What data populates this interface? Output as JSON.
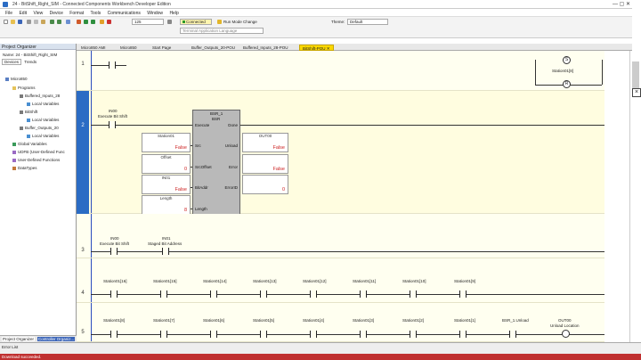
{
  "window": {
    "title": "24 - BitShift_Right_SIM - Connected Components Workbench Developer Edition",
    "controls": "—  ▢  ✕"
  },
  "menu": [
    "File",
    "Edit",
    "View",
    "Device",
    "Format",
    "Tools",
    "Communications",
    "Window",
    "Help"
  ],
  "toolbar": {
    "zoom_value": "125",
    "connection_status": "Connected",
    "run_mode_label": "Run Mode Change",
    "theme_label": "Theme:",
    "theme_value": "Default",
    "language_label": "Terminal Application Language"
  },
  "left_pane": {
    "header": "Project Organizer",
    "name_label": "Name:",
    "project_name": "24 - BitShift_Right_SIM",
    "tabs": [
      "Devices",
      "Trends"
    ],
    "tree": [
      "Micro850",
      "Programs",
      "Buffered_Inputs_28",
      "Local Variables",
      "BitShift",
      "Local Variables",
      "Buffer_Outputs_20",
      "Local Variables",
      "Global Variables",
      "UDFB (User-Defined Func",
      "User-Defined Functions",
      "DataTypes"
    ],
    "bottom_tabs": [
      "Project Organizer",
      "Controller Organiz..."
    ]
  },
  "doc_tabs": [
    {
      "label": "Micro850 AMI",
      "active": false
    },
    {
      "label": "Micro850",
      "active": false
    },
    {
      "label": "Start Page",
      "active": false
    },
    {
      "label": "Buffer_Outputs_20-POU",
      "active": false
    },
    {
      "label": "Buffered_Inputs_28-POU",
      "active": false
    },
    {
      "label": "BitShift-POU",
      "active": true
    }
  ],
  "ladder": {
    "rung1": {
      "number": "1",
      "coil_top": "Station01[8]"
    },
    "rung2": {
      "number": "2",
      "contact_name": "IN00",
      "contact_desc": "Execute Bit Shift",
      "block_instance": "BSR_1",
      "block_type": "BSR",
      "pin_execute": "Execute",
      "pin_done": "Done",
      "pin_src": "Src",
      "pin_srcoffset": "SrcOffset",
      "pin_bitaddr": "BitAddr",
      "pin_length": "Length",
      "pin_unload": "Unload",
      "pin_error": "Error",
      "pin_errorid": "ErrorID",
      "in1_name": "Station01",
      "in1_value": "False",
      "in2_name": "Offset",
      "in2_value": "0",
      "in3_name": "IN01",
      "in3_value": "False",
      "in4_name": "Length",
      "in4_value": "8",
      "out1_name": "OUT00",
      "out1_value": "False",
      "out2_value": "False",
      "out3_value": "0"
    },
    "rung3": {
      "number": "3",
      "c1_name": "IN00",
      "c1_desc": "Execute Bit Shift",
      "c2_name": "IN01",
      "c2_desc": "Staged Bit Address"
    },
    "rung4": {
      "number": "4",
      "contacts": [
        "Station01[16]",
        "Station01[15]",
        "Station01[14]",
        "Station01[13]",
        "Station01[12]",
        "Station01[11]",
        "Station01[10]",
        "Station01[9]"
      ]
    },
    "rung5": {
      "number": "5",
      "contacts": [
        "Station01[8]",
        "Station01[7]",
        "Station01[6]",
        "Station01[5]",
        "Station01[4]",
        "Station01[3]",
        "Station01[2]",
        "Station01[1]",
        "BSR_1.Unload"
      ],
      "coil_name": "OUT00",
      "coil_desc": "Unload Location"
    }
  },
  "bottom": {
    "error_list": "Error List",
    "status": "Download succeeded."
  },
  "colors": {
    "accent": "#2b4dbd",
    "active_tab": "#fbd800",
    "status_bar": "#c03030",
    "value_text": "#cc2222"
  }
}
